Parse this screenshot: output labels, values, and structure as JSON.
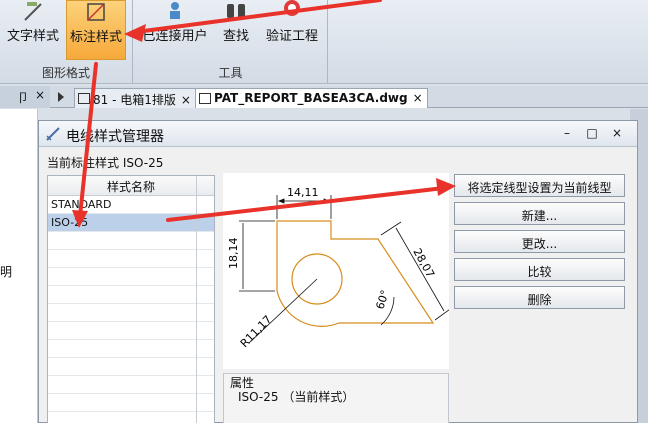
{
  "ribbon": {
    "groups": [
      {
        "label": "图形格式"
      },
      {
        "label": "工具"
      }
    ],
    "buttons": [
      {
        "label": "文字样式"
      },
      {
        "label": "标注样式"
      },
      {
        "label": "已连接用户"
      },
      {
        "label": "查找"
      },
      {
        "label": "验证工程"
      }
    ]
  },
  "panel": {
    "pin": "卩",
    "close": "×"
  },
  "tabs": [
    {
      "label": "81 - 电箱1排版"
    },
    {
      "label": "PAT_REPORT_BASEA3CA.dwg"
    }
  ],
  "left_strip": {
    "text": "明"
  },
  "dialog": {
    "title": "电线样式管理器",
    "current_style": "当前标注样式 ISO-25",
    "list_header": "样式名称",
    "styles": [
      "STANDARD",
      "ISO-25"
    ],
    "selected_style": "ISO-25",
    "buttons": [
      "将选定线型设置为当前线型",
      "新建...",
      "更改...",
      "比较",
      "删除"
    ],
    "props_label": "属性",
    "props_value": "ISO-25 （当前样式）",
    "preview_dims": [
      "14,11",
      "18,14",
      "28,07",
      "R11,17",
      "60°"
    ],
    "window_buttons": {
      "minimize": "–",
      "maximize": "□",
      "close": "×"
    }
  },
  "colors": {
    "accent": "#f7a93a",
    "arrow": "#e8322a",
    "dim": "#d88c1c"
  }
}
